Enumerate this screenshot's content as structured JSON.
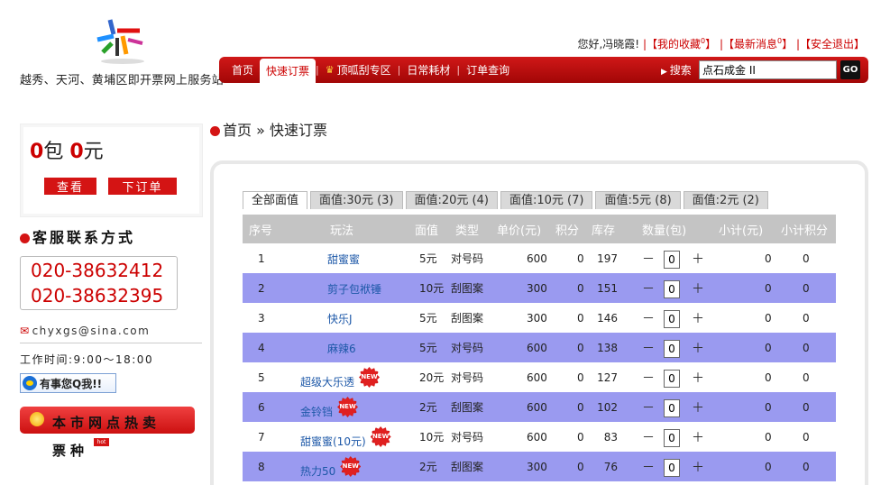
{
  "header": {
    "site_title": "越秀、天河、黄埔区即开票网上服务站",
    "greeting": "您好,冯晓霞!",
    "favorites": "【我的收藏",
    "favorites_count": "0",
    "favorites_close": "】",
    "news": "【最新消息",
    "news_count": "0",
    "news_close": "】",
    "logout": "【安全退出】",
    "sep": "|"
  },
  "nav": {
    "items": [
      "首页",
      "快速订票",
      "顶呱刮专区",
      "日常耗材",
      "订单查询"
    ],
    "search_label": "搜索",
    "search_value": "点石成金 II",
    "go_label": "GO"
  },
  "sidebar": {
    "bags": "0",
    "bags_unit": "包",
    "amount": "0",
    "amount_unit": "元",
    "view_label": "查看",
    "order_label": "下订单",
    "cs_title": "客服联系方式",
    "phone1": "020-38632412",
    "phone2": "020-38632395",
    "email": "chyxgs@sina.com",
    "worktime": "工作时间:9:00～18:00",
    "qq_label": "有事您Q我!!",
    "hot_title": "本市网点热卖",
    "hot_title2": "票种",
    "hot_tag": "hot"
  },
  "breadcrumb": {
    "home": "首页",
    "sep": "»",
    "current": "快速订票"
  },
  "tabs": [
    "全部面值",
    "面值:30元 (3)",
    "面值:20元 (4)",
    "面值:10元 (7)",
    "面值:5元 (8)",
    "面值:2元 (2)"
  ],
  "table": {
    "headers": [
      "序号",
      "玩法",
      "面值",
      "类型",
      "单价(元)",
      "积分",
      "库存",
      "数量(包)",
      "小计(元)",
      "小计积分"
    ],
    "new_label": "NEW",
    "minus": "－",
    "plus": "＋",
    "rows": [
      {
        "no": "1",
        "name": "甜蜜蜜",
        "value": "5元",
        "type": "对号码",
        "price": "600",
        "points": "0",
        "stock": "197",
        "qty": "0",
        "subtotal": "0",
        "subpoints": "0",
        "is_new": false
      },
      {
        "no": "2",
        "name": "剪子包袱锤",
        "value": "10元",
        "type": "刮图案",
        "price": "300",
        "points": "0",
        "stock": "151",
        "qty": "0",
        "subtotal": "0",
        "subpoints": "0",
        "is_new": false
      },
      {
        "no": "3",
        "name": "快乐J",
        "value": "5元",
        "type": "刮图案",
        "price": "300",
        "points": "0",
        "stock": "146",
        "qty": "0",
        "subtotal": "0",
        "subpoints": "0",
        "is_new": false
      },
      {
        "no": "4",
        "name": "麻辣6",
        "value": "5元",
        "type": "对号码",
        "price": "600",
        "points": "0",
        "stock": "138",
        "qty": "0",
        "subtotal": "0",
        "subpoints": "0",
        "is_new": false
      },
      {
        "no": "5",
        "name": "超级大乐透",
        "value": "20元",
        "type": "对号码",
        "price": "600",
        "points": "0",
        "stock": "127",
        "qty": "0",
        "subtotal": "0",
        "subpoints": "0",
        "is_new": true
      },
      {
        "no": "6",
        "name": "金铃铛",
        "value": "2元",
        "type": "刮图案",
        "price": "600",
        "points": "0",
        "stock": "102",
        "qty": "0",
        "subtotal": "0",
        "subpoints": "0",
        "is_new": true
      },
      {
        "no": "7",
        "name": "甜蜜蜜(10元)",
        "value": "10元",
        "type": "对号码",
        "price": "600",
        "points": "0",
        "stock": "83",
        "qty": "0",
        "subtotal": "0",
        "subpoints": "0",
        "is_new": true
      },
      {
        "no": "8",
        "name": "热力50",
        "value": "2元",
        "type": "刮图案",
        "price": "300",
        "points": "0",
        "stock": "76",
        "qty": "0",
        "subtotal": "0",
        "subpoints": "0",
        "is_new": true
      }
    ]
  },
  "colors": {
    "brand_red": "#c00000",
    "row_alt": "#9a9af0",
    "header_gray": "#c4c4c4",
    "link_blue": "#1d58a8"
  }
}
